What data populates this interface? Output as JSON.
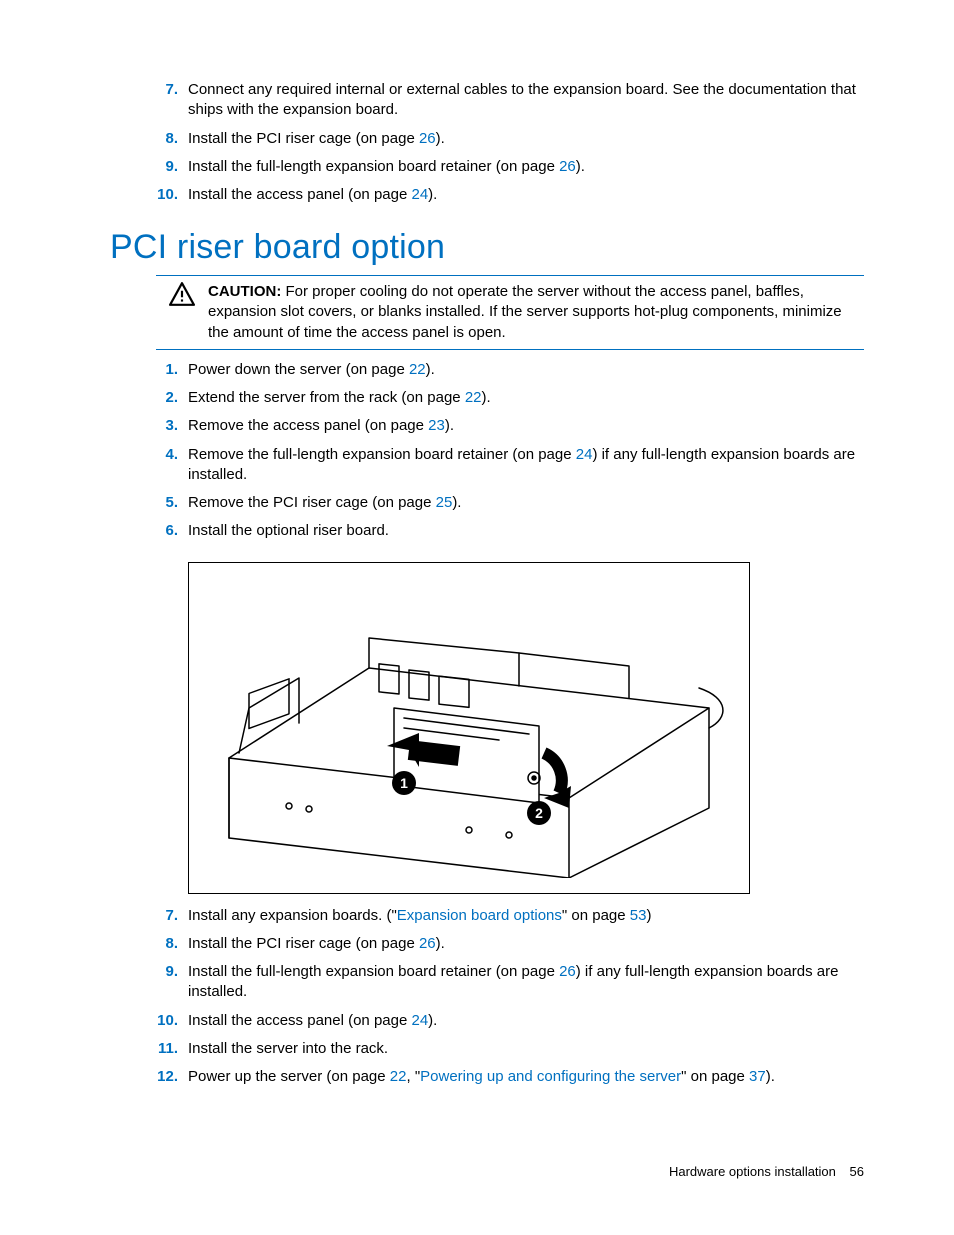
{
  "top_steps": [
    {
      "n": "7.",
      "pre": "Connect any required internal or external cables to the expansion board. See the documentation that ships with the expansion board."
    },
    {
      "n": "8.",
      "pre": "Install the PCI riser cage (on page ",
      "link": "26",
      "post": ")."
    },
    {
      "n": "9.",
      "pre": "Install the full-length expansion board retainer (on page ",
      "link": "26",
      "post": ")."
    },
    {
      "n": "10.",
      "pre": "Install the access panel (on page ",
      "link": "24",
      "post": ")."
    }
  ],
  "section_title": "PCI riser board option",
  "caution": {
    "label": "CAUTION:",
    "text": "  For proper cooling do not operate the server without the access panel, baffles, expansion slot covers, or blanks installed. If the server supports hot-plug components, minimize the amount of time the access panel is open."
  },
  "mid_steps": [
    {
      "n": "1.",
      "pre": "Power down the server (on page ",
      "link": "22",
      "post": ")."
    },
    {
      "n": "2.",
      "pre": "Extend the server from the rack (on page ",
      "link": "22",
      "post": ")."
    },
    {
      "n": "3.",
      "pre": "Remove the access panel (on page ",
      "link": "23",
      "post": ")."
    },
    {
      "n": "4.",
      "pre": "Remove the full-length expansion board retainer (on page ",
      "link": "24",
      "post": ") if any full-length expansion boards are installed."
    },
    {
      "n": "5.",
      "pre": "Remove the PCI riser cage (on page ",
      "link": "25",
      "post": ")."
    },
    {
      "n": "6.",
      "pre": "Install the optional riser board."
    }
  ],
  "bot_steps": [
    {
      "n": "7.",
      "pre": "Install any expansion boards. (\"",
      "linktext": "Expansion board options",
      "mid": "\" on page ",
      "link": "53",
      "post": ")"
    },
    {
      "n": "8.",
      "pre": "Install the PCI riser cage (on page ",
      "link": "26",
      "post": ")."
    },
    {
      "n": "9.",
      "pre": "Install the full-length expansion board retainer (on page ",
      "link": "26",
      "post": ") if any full-length expansion boards are installed."
    },
    {
      "n": "10.",
      "pre": "Install the access panel (on page ",
      "link": "24",
      "post": ")."
    },
    {
      "n": "11.",
      "pre": "Install the server into the rack."
    },
    {
      "n": "12.",
      "pre": "Power up the server (on page ",
      "link": "22",
      "mid": ", \"",
      "linktext": "Powering up and configuring the server",
      "mid2": "\" on page ",
      "link2": "37",
      "post": ")."
    }
  ],
  "footer": {
    "section": "Hardware options installation",
    "page": "56"
  },
  "diagram": {
    "callouts": [
      "1",
      "2"
    ],
    "alt": "Install the optional riser board into the server chassis"
  }
}
